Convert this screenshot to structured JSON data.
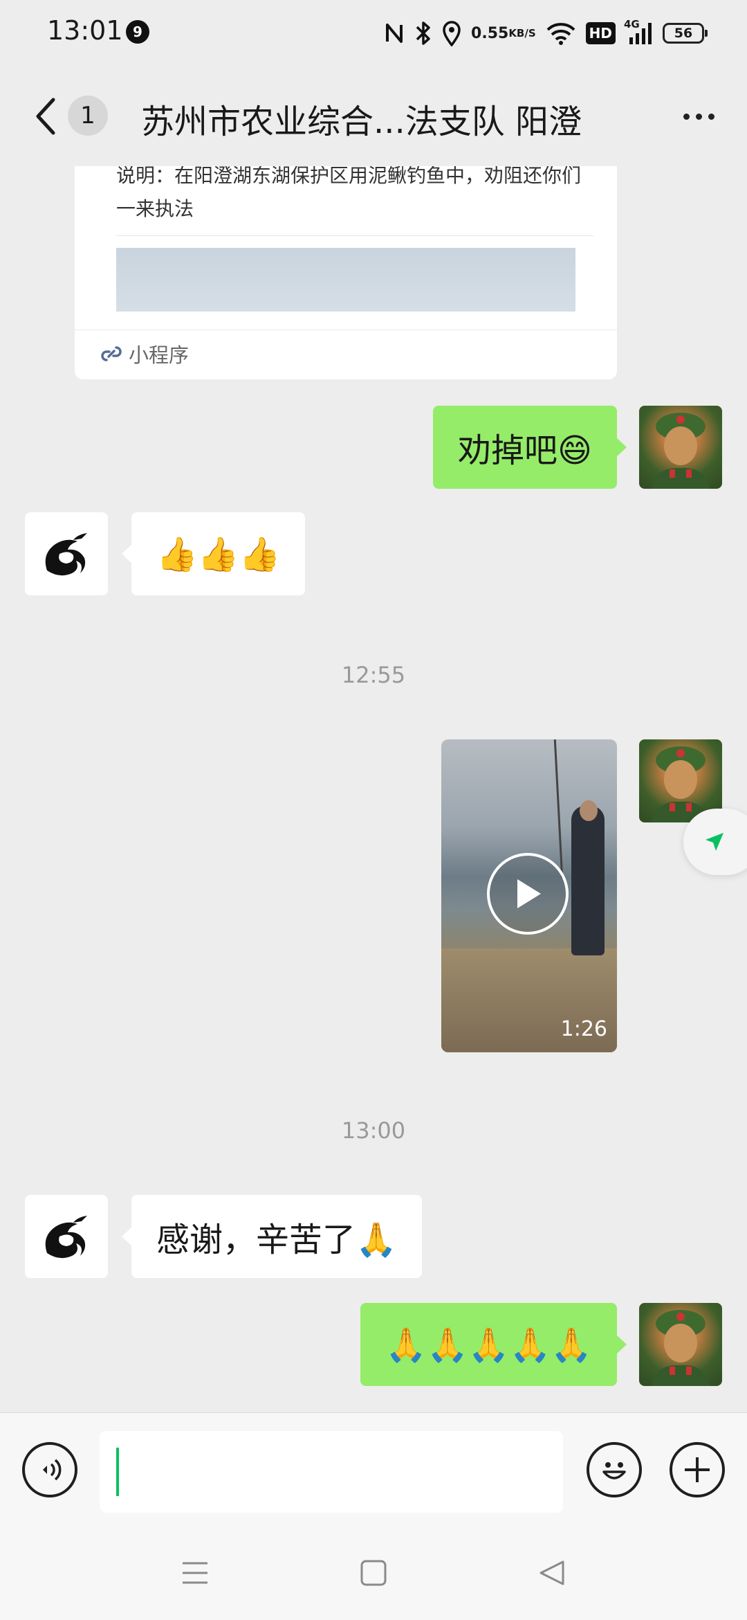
{
  "status_bar": {
    "time": "13:01",
    "notification_count": "9",
    "net_speed_value": "0.55",
    "net_speed_unit": "KB/S",
    "hd": "HD",
    "network": "4G",
    "battery": "56",
    "icons": [
      "nfc-icon",
      "bluetooth-icon",
      "location-icon",
      "wifi-icon",
      "signal-icon"
    ]
  },
  "header": {
    "unread_count": "1",
    "title": "苏州市农业综合...法支队 阳澄"
  },
  "mini_program_card": {
    "description": "说明：在阳澄湖东湖保护区用泥鳅钓鱼中，劝阻还你们一来执法",
    "footer_label": "小程序"
  },
  "messages": [
    {
      "sender": "me",
      "text": "劝掉吧😄"
    },
    {
      "sender": "other",
      "text": "👍👍👍"
    },
    {
      "type": "timestamp",
      "text": "12:55"
    },
    {
      "sender": "me",
      "type": "video",
      "duration": "1:26"
    },
    {
      "type": "timestamp",
      "text": "13:00"
    },
    {
      "sender": "other",
      "text": "感谢，辛苦了🙏"
    },
    {
      "sender": "me",
      "text": "🙏🙏🙏🙏🙏"
    }
  ],
  "input": {
    "value": "",
    "placeholder": ""
  },
  "colors": {
    "background": "#ededed",
    "my_bubble": "#95ec69",
    "other_bubble": "#ffffff",
    "accent": "#07c160",
    "mini_program_link": "#576b95"
  }
}
